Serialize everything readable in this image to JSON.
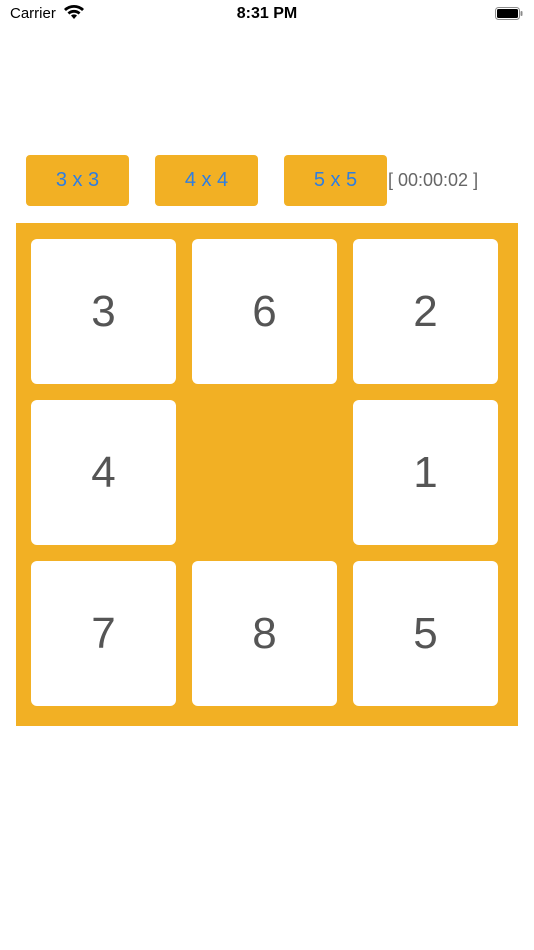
{
  "status_bar": {
    "carrier": "Carrier",
    "time": "8:31 PM"
  },
  "size_buttons": [
    {
      "label": "3 x 3"
    },
    {
      "label": "4 x 4"
    },
    {
      "label": "5 x 5"
    }
  ],
  "timer": "[ 00:00:02 ]",
  "board": {
    "grid_size": 3,
    "tiles": [
      "3",
      "6",
      "2",
      "4",
      "",
      "1",
      "7",
      "8",
      "5"
    ]
  },
  "colors": {
    "accent": "#f2b024",
    "button_text": "#2f7ee0",
    "tile_text": "#555555",
    "tile_bg": "#ffffff"
  }
}
